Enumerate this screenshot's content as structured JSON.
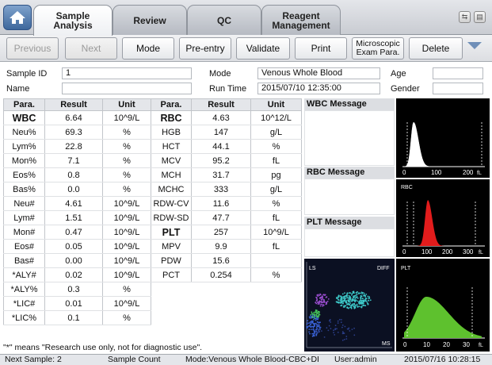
{
  "tabs": [
    {
      "line1": "Sample",
      "line2": "Analysis"
    },
    {
      "line1": "Review",
      "line2": ""
    },
    {
      "line1": "QC",
      "line2": ""
    },
    {
      "line1": "Reagent",
      "line2": "Management"
    }
  ],
  "toolbar": {
    "previous": "Previous",
    "next": "Next",
    "mode": "Mode",
    "pre_entry": "Pre-entry",
    "validate": "Validate",
    "print": "Print",
    "microscopic_line1": "Microscopic",
    "microscopic_line2": "Exam Para.",
    "delete": "Delete"
  },
  "sample_info": {
    "sample_id_label": "Sample ID",
    "sample_id": "1",
    "name_label": "Name",
    "name": "",
    "mode_label": "Mode",
    "mode": "Venous Whole Blood",
    "run_time_label": "Run Time",
    "run_time": "2015/07/10 12:35:00",
    "age_label": "Age",
    "age": "",
    "gender_label": "Gender",
    "gender": ""
  },
  "table": {
    "headers": [
      "Para.",
      "Result",
      "Unit",
      "Para.",
      "Result",
      "Unit"
    ],
    "rows": [
      [
        "WBC",
        "6.64",
        "10^9/L",
        "RBC",
        "4.63",
        "10^12/L"
      ],
      [
        "Neu%",
        "69.3",
        "%",
        "HGB",
        "147",
        "g/L"
      ],
      [
        "Lym%",
        "22.8",
        "%",
        "HCT",
        "44.1",
        "%"
      ],
      [
        "Mon%",
        "7.1",
        "%",
        "MCV",
        "95.2",
        "fL"
      ],
      [
        "Eos%",
        "0.8",
        "%",
        "MCH",
        "31.7",
        "pg"
      ],
      [
        "Bas%",
        "0.0",
        "%",
        "MCHC",
        "333",
        "g/L"
      ],
      [
        "Neu#",
        "4.61",
        "10^9/L",
        "RDW-CV",
        "11.6",
        "%"
      ],
      [
        "Lym#",
        "1.51",
        "10^9/L",
        "RDW-SD",
        "47.7",
        "fL"
      ],
      [
        "Mon#",
        "0.47",
        "10^9/L",
        "PLT",
        "257",
        "10^9/L"
      ],
      [
        "Eos#",
        "0.05",
        "10^9/L",
        "MPV",
        "9.9",
        "fL"
      ],
      [
        "Bas#",
        "0.00",
        "10^9/L",
        "PDW",
        "15.6",
        ""
      ],
      [
        "*ALY#",
        "0.02",
        "10^9/L",
        "PCT",
        "0.254",
        "%"
      ],
      [
        "*ALY%",
        "0.3",
        "%",
        "",
        "",
        ""
      ],
      [
        "*LIC#",
        "0.01",
        "10^9/L",
        "",
        "",
        ""
      ],
      [
        "*LIC%",
        "0.1",
        "%",
        "",
        "",
        ""
      ]
    ]
  },
  "messages": {
    "wbc": "WBC Message",
    "rbc": "RBC Message",
    "plt": "PLT Message"
  },
  "graphs": {
    "wbc_hist": {
      "ticks": [
        "0",
        "100",
        "200"
      ],
      "unit": "fL"
    },
    "rbc_hist": {
      "title": "RBC",
      "ticks": [
        "0",
        "100",
        "200",
        "300"
      ],
      "unit": "fL",
      "color": "#e21c1c"
    },
    "plt_hist": {
      "title": "PLT",
      "ticks": [
        "0",
        "10",
        "20",
        "30"
      ],
      "unit": "fL",
      "color": "#5ec12e"
    },
    "scatter": {
      "y_label": "LS",
      "corner_label": "DIFF",
      "x_label": "MS"
    }
  },
  "footnote": "\"*\" means \"Research use only, not for diagnostic use\".",
  "status": {
    "next_sample": "Next Sample: 2",
    "sample_count": "Sample Count",
    "mode": "Mode:Venous Whole Blood-CBC+DI",
    "user": "User:admin",
    "datetime": "2015/07/16 10:28:15"
  },
  "colors": {
    "accent": "#4a73a8",
    "rbc_curve": "#e21c1c",
    "plt_curve": "#5ec12e"
  }
}
